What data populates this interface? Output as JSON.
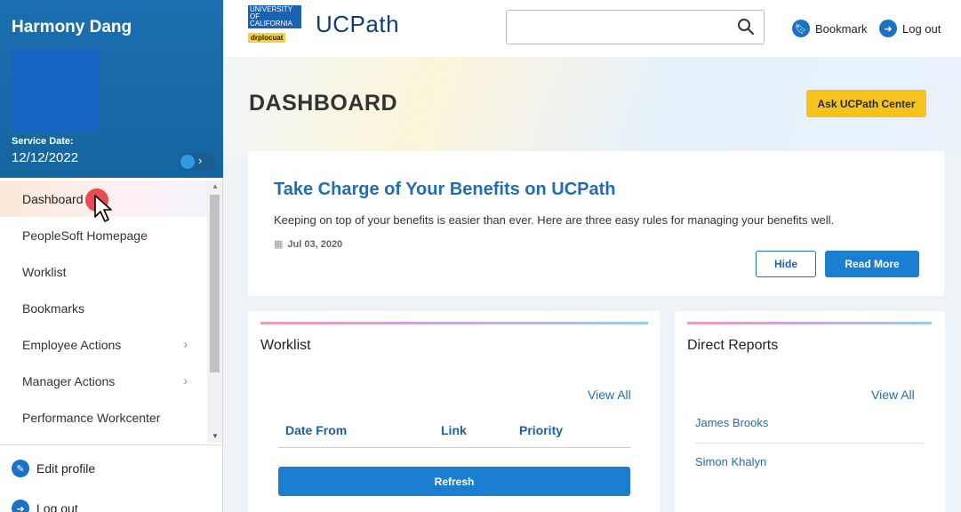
{
  "user": {
    "name": "Harmony Dang",
    "service_date_label": "Service Date:",
    "service_date": "12/12/2022"
  },
  "sidebar": {
    "items": [
      {
        "label": "Dashboard",
        "active": true
      },
      {
        "label": "PeopleSoft Homepage"
      },
      {
        "label": "Worklist"
      },
      {
        "label": "Bookmarks"
      },
      {
        "label": "Employee Actions",
        "has_submenu": true
      },
      {
        "label": "Manager Actions",
        "has_submenu": true
      },
      {
        "label": "Performance Workcenter"
      }
    ],
    "footer": {
      "edit_profile": "Edit profile",
      "log_out": "Log out"
    }
  },
  "header": {
    "logo_line1": "UNIVERSITY",
    "logo_line2": "OF",
    "logo_line3": "CALIFORNIA",
    "env_tag": "drplocuat",
    "brand": "UCPath",
    "search_placeholder": "",
    "bookmark_label": "Bookmark",
    "logout_label": "Log out"
  },
  "hero": {
    "title": "DASHBOARD",
    "ask_button": "Ask UCPath Center"
  },
  "benefits": {
    "title": "Take Charge of Your Benefits on UCPath",
    "description": "Keeping on top of your benefits is easier than ever. Here are three easy rules for managing your benefits well.",
    "date": "Jul 03, 2020",
    "hide_label": "Hide",
    "read_more_label": "Read More"
  },
  "worklist": {
    "title": "Worklist",
    "view_all": "View All",
    "columns": [
      "Date From",
      "Link",
      "Priority"
    ],
    "refresh_label": "Refresh"
  },
  "direct_reports": {
    "title": "Direct Reports",
    "view_all": "View All",
    "people": [
      "James Brooks",
      "Simon Khalyn"
    ]
  },
  "colors": {
    "sidebar_header": "#1b6fb0",
    "accent_blue": "#1a7fd0",
    "ask_button": "#f7c21b",
    "link": "#1f6db2"
  }
}
